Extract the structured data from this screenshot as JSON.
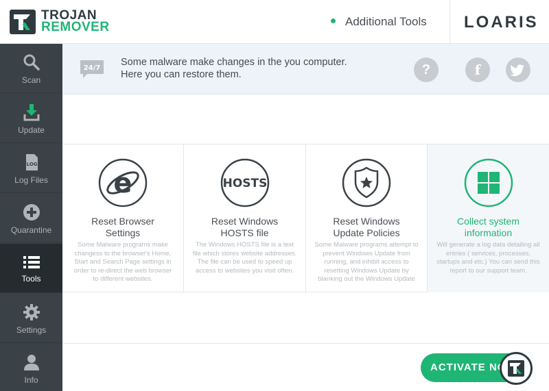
{
  "app": {
    "logo_line1": "TROJAN",
    "logo_line2": "REMOVER",
    "page_heading": "Additional Tools",
    "brand": "LOARIS"
  },
  "sidebar": {
    "items": [
      {
        "label": "Scan",
        "icon": "search-icon"
      },
      {
        "label": "Update",
        "icon": "download-icon"
      },
      {
        "label": "Log Files",
        "icon": "log-file-icon"
      },
      {
        "label": "Quarantine",
        "icon": "plus-circle-icon"
      },
      {
        "label": "Tools",
        "icon": "list-icon",
        "active": true
      },
      {
        "label": "Settings",
        "icon": "gear-icon"
      },
      {
        "label": "Info",
        "icon": "user-icon"
      }
    ]
  },
  "banner": {
    "badge": "24/7",
    "line1": "Some malware make changes in the you computer.",
    "line2": "Here you can restore them.",
    "help": "?",
    "facebook": "f",
    "twitter": "twitter"
  },
  "cards": [
    {
      "title1": "Reset Browser",
      "title2": "Settings",
      "icon": "ie-browser-icon",
      "desc": "Some Malware programs make changess to the browser's Home, Start and Search Page settings in order to re-direct the web browser to different websites."
    },
    {
      "title1": "Reset Windows",
      "title2": "HOSTS file",
      "icon": "hosts-icon",
      "icon_text": "HOSTS",
      "desc": "The Windows HOSTS file is a text file which stores website addresses. The file can be used to speed up access to websites you visit often."
    },
    {
      "title1": "Reset Windows",
      "title2": "Update Policies",
      "icon": "shield-badge-icon",
      "desc": "Some Malware programs attempt to prevent Windows Update from running, and inhibit access to resetting Windows Update by blanking out the Windows Update"
    },
    {
      "title1": "Collect system",
      "title2": "information",
      "icon": "windows-icon",
      "active": true,
      "desc": "Will generate a log data detailing all entries ( services, processes, startups and etc.) You can send this report to our support team."
    }
  ],
  "activate": {
    "label": "ACTIVATE NOW"
  },
  "colors": {
    "accent": "#1fb574",
    "sidebar": "#3b4247",
    "sidebar_active": "#262b2f",
    "banner_bg": "#edf3f8"
  }
}
